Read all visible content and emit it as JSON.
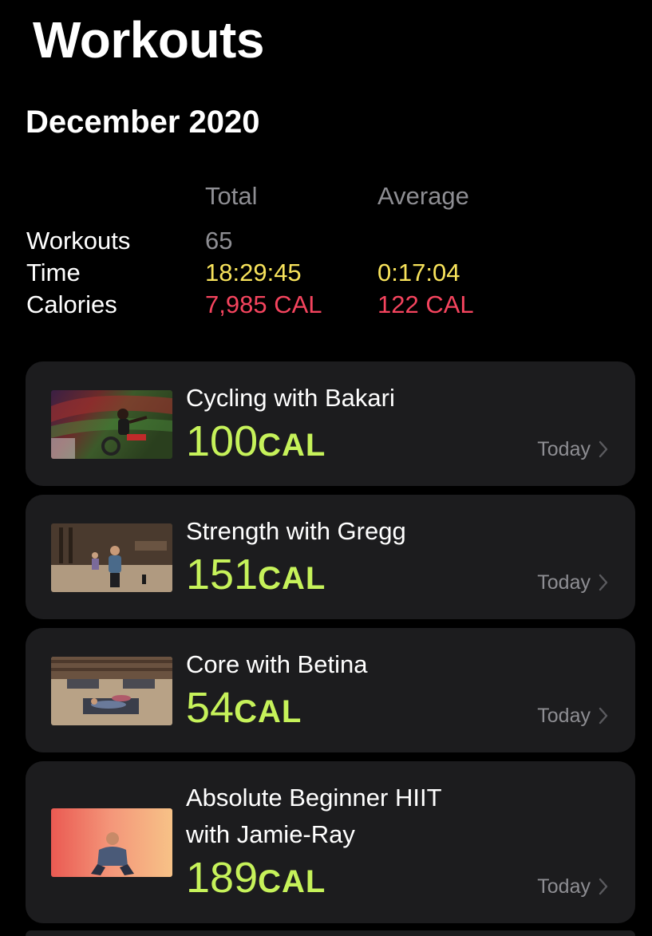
{
  "header": {
    "title": "Workouts"
  },
  "summary": {
    "month": "December 2020",
    "col_total": "Total",
    "col_average": "Average",
    "rows": [
      {
        "label": "Workouts",
        "total": "65",
        "average": ""
      },
      {
        "label": "Time",
        "total": "18:29:45",
        "average": "0:17:04"
      },
      {
        "label": "Calories",
        "total": "7,985 CAL",
        "average": "122 CAL"
      }
    ]
  },
  "workouts": [
    {
      "title": "Cycling with Bakari",
      "calories": "100",
      "unit": "CAL",
      "date": "Today",
      "thumb_icon": "cycling-thumbnail"
    },
    {
      "title": "Strength with Gregg",
      "calories": "151",
      "unit": "CAL",
      "date": "Today",
      "thumb_icon": "strength-thumbnail"
    },
    {
      "title": "Core with Betina",
      "calories": "54",
      "unit": "CAL",
      "date": "Today",
      "thumb_icon": "core-thumbnail"
    },
    {
      "title_line1": "Absolute Beginner HIIT",
      "title_line2": "with Jamie-Ray",
      "calories": "189",
      "unit": "CAL",
      "date": "Today",
      "thumb_icon": "hiit-thumbnail"
    }
  ],
  "colors": {
    "background": "#000000",
    "card": "#1c1c1e",
    "calories_green": "#c6f25a",
    "time_yellow": "#f7e25b",
    "calories_red": "#f5445e",
    "secondary_gray": "#8e8e93"
  }
}
